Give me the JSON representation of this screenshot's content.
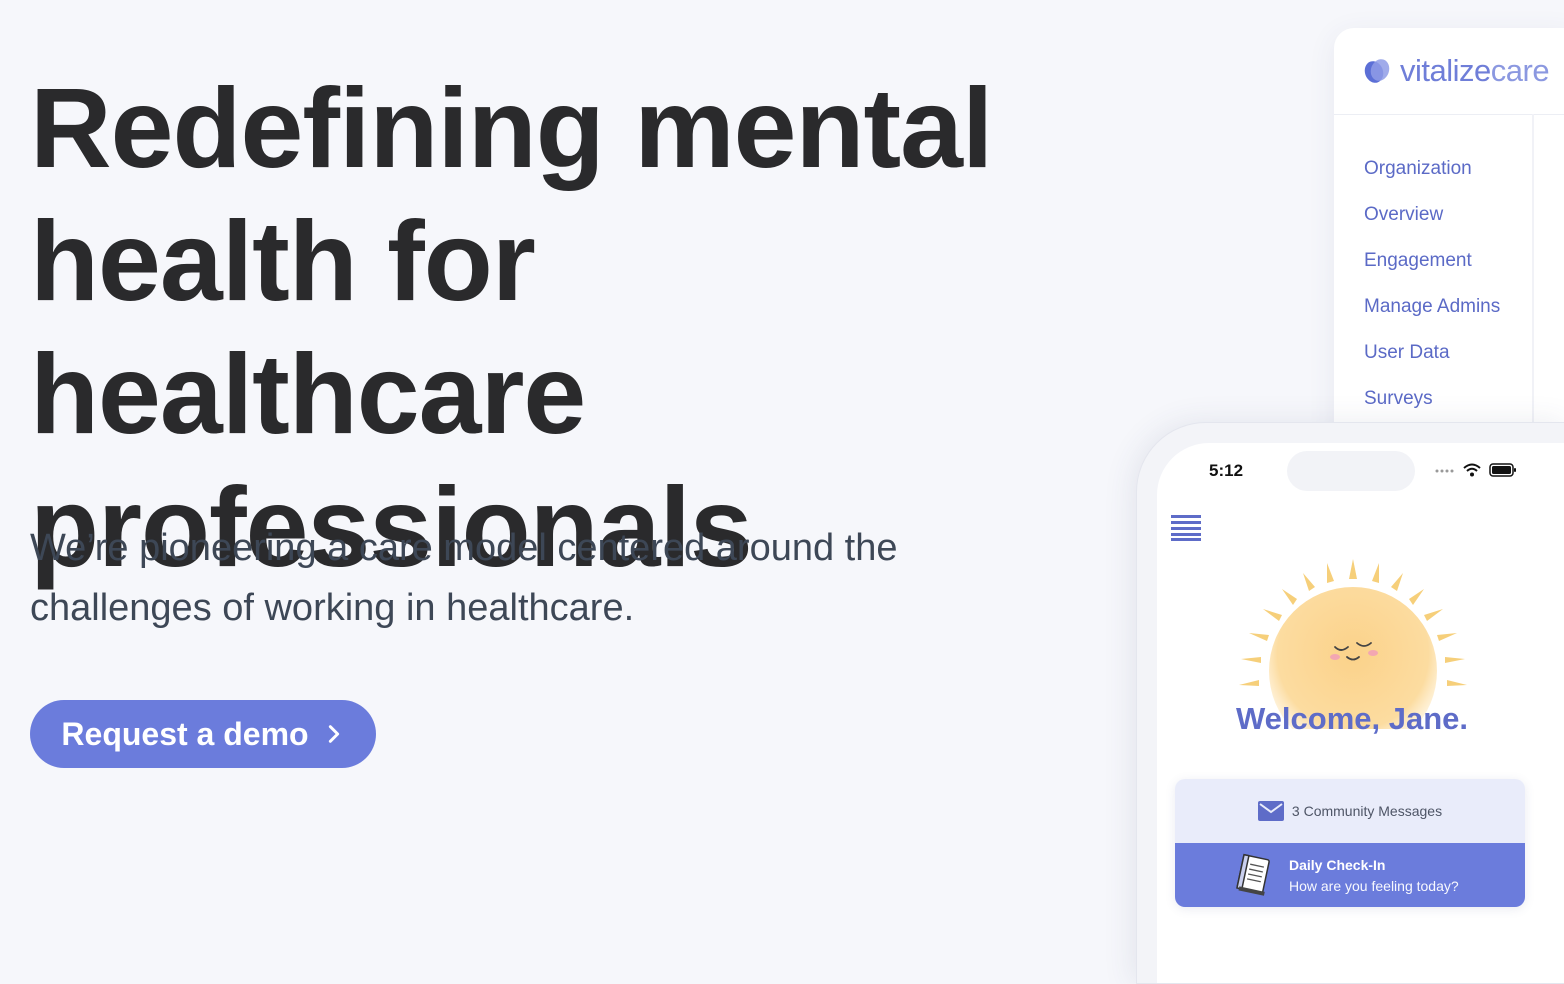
{
  "hero": {
    "title": "Redefining mental health for healthcare professionals",
    "subtitle": "We’re pioneering a care model centered around the challenges of working in healthcare.",
    "cta_label": "Request a demo"
  },
  "dashboard": {
    "logo_text_a": "vitalize",
    "logo_text_b": "care",
    "nav": [
      "Organization",
      "Overview",
      "Engagement",
      "Manage Admins",
      "User Data",
      "Surveys"
    ]
  },
  "phone": {
    "time": "5:12",
    "welcome": "Welcome, Jane.",
    "messages_label": "3 Community Messages",
    "checkin_title": "Daily Check-In",
    "checkin_subtitle": "How are you feeling today?"
  },
  "colors": {
    "accent": "#6b7cdc",
    "nav_text": "#5b6ac6",
    "heading": "#2a2a2c",
    "sun": "#fbd28a"
  },
  "icons": [
    "chevron-right-icon",
    "logo-icon",
    "wifi-icon",
    "battery-icon",
    "signal-icon",
    "menu-icon",
    "sun-illustration",
    "mail-icon",
    "journal-icon"
  ]
}
